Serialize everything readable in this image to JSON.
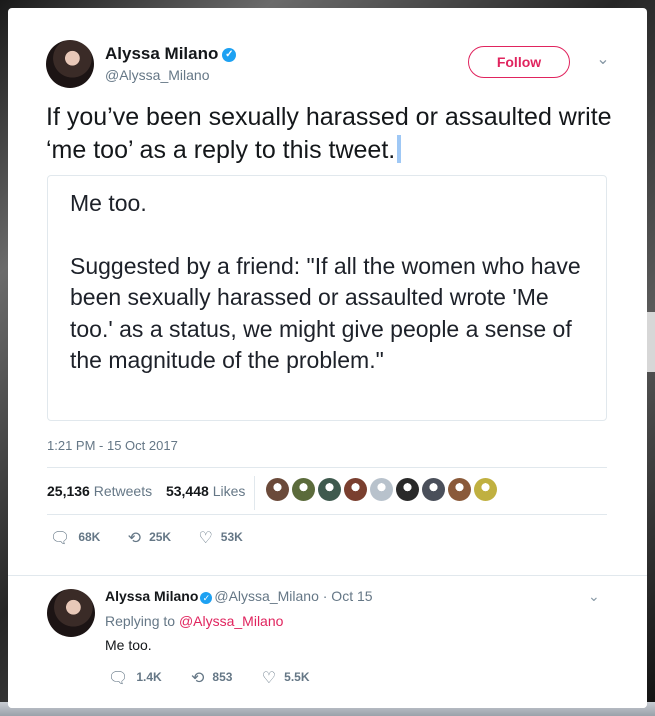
{
  "tweet": {
    "author_name": "Alyssa Milano",
    "author_handle": "@Alyssa_Milano",
    "follow_label": "Follow",
    "text": "If you’ve been sexually harassed or assaulted write ‘me too’ as a reply to this tweet.",
    "quote_line1": "Me too.",
    "quote_line2": "Suggested by a friend: \"If all the women who have been sexually harassed or assaulted wrote 'Me too.' as a status, we might give people a sense of the magnitude of the problem.\"",
    "timestamp": "1:21 PM - 15 Oct 2017",
    "retweets_count": "25,136",
    "retweets_label": "Retweets",
    "likes_count": "53,448",
    "likes_label": "Likes",
    "reply_count": "68K",
    "retweet_count_short": "25K",
    "like_count_short": "53K"
  },
  "likers": [
    {
      "icon": "liker-avatar",
      "color": "#6b4a3a"
    },
    {
      "icon": "liker-avatar",
      "color": "#5b6b3b"
    },
    {
      "icon": "liker-avatar",
      "color": "#3f5a4e"
    },
    {
      "icon": "liker-avatar",
      "color": "#7a3f2f"
    },
    {
      "icon": "default-avatar",
      "color": "#b8c2cc"
    },
    {
      "icon": "liker-avatar",
      "color": "#2a2a2a"
    },
    {
      "icon": "liker-avatar",
      "color": "#4a4f5a"
    },
    {
      "icon": "liker-avatar",
      "color": "#8a5a3a"
    },
    {
      "icon": "liker-avatar",
      "color": "#c0b040"
    }
  ],
  "reply": {
    "author_name": "Alyssa Milano",
    "author_handle": "@Alyssa_Milano",
    "date": "· Oct 15",
    "replying_prefix": "Replying to",
    "replying_handle": "@Alyssa_Milano",
    "text": "Me too.",
    "reply_count": "1.4K",
    "retweet_count": "853",
    "like_count": "5.5K"
  },
  "colors": {
    "accent": "#e0245e",
    "verified": "#1da1f2",
    "muted": "#657786"
  }
}
